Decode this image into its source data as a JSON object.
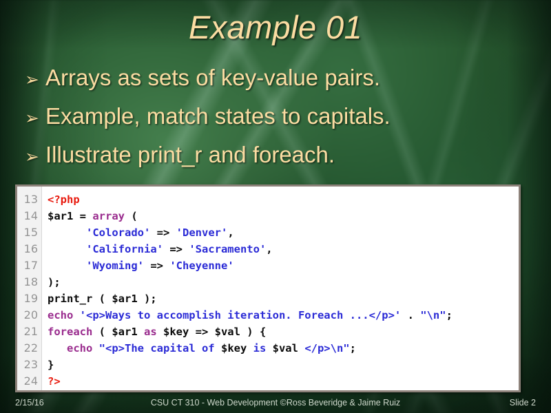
{
  "slide": {
    "title": "Example 01",
    "bullet_marker": "➢",
    "bullets": [
      {
        "text": "Arrays as sets of key-value pairs."
      },
      {
        "text": "Example, match states to capitals."
      },
      {
        "text": "Illustrate print_r and foreach."
      }
    ]
  },
  "colors": {
    "title_text": "#fbdca2",
    "bullet_text": "#fbdca2",
    "background_green": "#21532e",
    "code_background": "#ffffff",
    "code_border": "#8d827a",
    "gutter_background": "#f2f2f2",
    "line_number": "#949494",
    "token_tag": "#e81b0f",
    "token_keyword": "#9a2c8e",
    "token_string": "#2b2bd6",
    "token_plain": "#0a0a0a",
    "footer_text": "#cfd8cc"
  },
  "code": {
    "language": "php",
    "first_line_number": 13,
    "last_line_number": 24,
    "line_numbers": [
      "13",
      "14",
      "15",
      "16",
      "17",
      "18",
      "19",
      "20",
      "21",
      "22",
      "23",
      "24"
    ],
    "lines": [
      {
        "n": "13",
        "text": "<?php",
        "tokens": [
          {
            "t": "<?php",
            "c": "tag"
          }
        ]
      },
      {
        "n": "14",
        "text": "$ar1 = array (",
        "tokens": [
          {
            "t": "$ar1 = ",
            "c": "plain"
          },
          {
            "t": "array",
            "c": "kw"
          },
          {
            "t": " (",
            "c": "plain"
          }
        ]
      },
      {
        "n": "15",
        "text": "      'Colorado' => 'Denver',",
        "tokens": [
          {
            "t": "      ",
            "c": "plain"
          },
          {
            "t": "'Colorado'",
            "c": "str"
          },
          {
            "t": " => ",
            "c": "plain"
          },
          {
            "t": "'Denver'",
            "c": "str"
          },
          {
            "t": ",",
            "c": "plain"
          }
        ]
      },
      {
        "n": "16",
        "text": "      'California' => 'Sacramento',",
        "tokens": [
          {
            "t": "      ",
            "c": "plain"
          },
          {
            "t": "'California'",
            "c": "str"
          },
          {
            "t": " => ",
            "c": "plain"
          },
          {
            "t": "'Sacramento'",
            "c": "str"
          },
          {
            "t": ",",
            "c": "plain"
          }
        ]
      },
      {
        "n": "17",
        "text": "      'Wyoming' => 'Cheyenne'",
        "tokens": [
          {
            "t": "      ",
            "c": "plain"
          },
          {
            "t": "'Wyoming'",
            "c": "str"
          },
          {
            "t": " => ",
            "c": "plain"
          },
          {
            "t": "'Cheyenne'",
            "c": "str"
          }
        ]
      },
      {
        "n": "18",
        "text": ");",
        "tokens": [
          {
            "t": ");",
            "c": "plain"
          }
        ]
      },
      {
        "n": "19",
        "text": "print_r ( $ar1 );",
        "tokens": [
          {
            "t": "print_r ( $ar1 );",
            "c": "plain"
          }
        ]
      },
      {
        "n": "20",
        "text": "echo '<p>Ways to accomplish iteration. Foreach ...</p>' . \"\\n\";",
        "tokens": [
          {
            "t": "echo",
            "c": "kw"
          },
          {
            "t": " ",
            "c": "plain"
          },
          {
            "t": "'<p>Ways to accomplish iteration. Foreach ...</p>'",
            "c": "str"
          },
          {
            "t": " . ",
            "c": "plain"
          },
          {
            "t": "\"\\n\"",
            "c": "str"
          },
          {
            "t": ";",
            "c": "plain"
          }
        ]
      },
      {
        "n": "21",
        "text": "foreach ( $ar1 as $key => $val ) {",
        "tokens": [
          {
            "t": "foreach",
            "c": "kw"
          },
          {
            "t": " ( $ar1 ",
            "c": "plain"
          },
          {
            "t": "as",
            "c": "kw"
          },
          {
            "t": " $key => $val ) {",
            "c": "plain"
          }
        ]
      },
      {
        "n": "22",
        "text": "   echo \"<p>The capital of $key is $val </p>\\n\";",
        "tokens": [
          {
            "t": "   ",
            "c": "plain"
          },
          {
            "t": "echo",
            "c": "kw"
          },
          {
            "t": " ",
            "c": "plain"
          },
          {
            "t": "\"<p>The capital of ",
            "c": "str"
          },
          {
            "t": "$key",
            "c": "plain"
          },
          {
            "t": " is ",
            "c": "str"
          },
          {
            "t": "$val",
            "c": "plain"
          },
          {
            "t": " ",
            "c": "str"
          },
          {
            "t": "</p>\\n\"",
            "c": "str"
          },
          {
            "t": ";",
            "c": "plain"
          }
        ]
      },
      {
        "n": "23",
        "text": "}",
        "tokens": [
          {
            "t": "}",
            "c": "plain"
          }
        ]
      },
      {
        "n": "24",
        "text": "?>",
        "tokens": [
          {
            "t": "?>",
            "c": "tag"
          }
        ]
      }
    ]
  },
  "footer": {
    "date": "2/15/16",
    "center": "CSU CT 310 - Web Development ©Ross Beveridge & Jaime Ruiz",
    "slide_number": "Slide 2"
  }
}
